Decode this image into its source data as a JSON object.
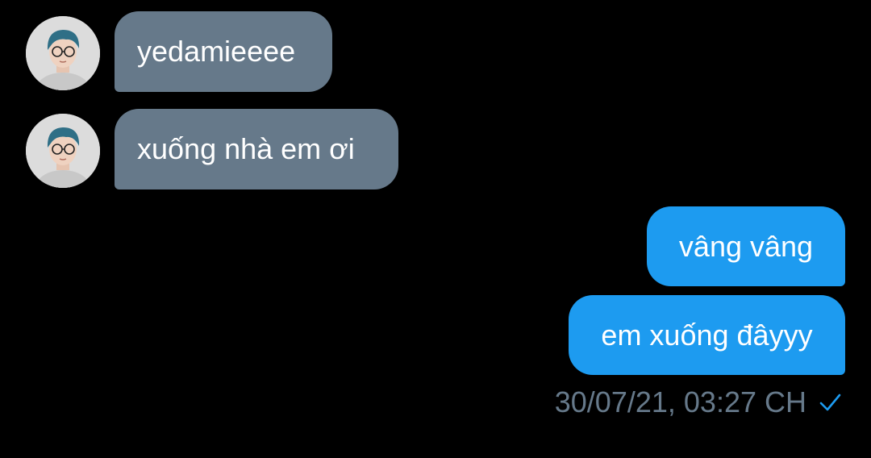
{
  "conversation": {
    "messages": [
      {
        "direction": "incoming",
        "text": "yedamieeee"
      },
      {
        "direction": "incoming",
        "text": "xuống nhà em ơi"
      },
      {
        "direction": "outgoing",
        "text": "vâng vâng"
      },
      {
        "direction": "outgoing",
        "text": "em xuống đâyyy"
      }
    ],
    "timestamp": "30/07/21, 03:27 CH"
  },
  "icons": {
    "sent_status": "check-icon",
    "avatar": "avatar-photo"
  },
  "colors": {
    "background": "#000000",
    "incoming_bubble": "#66798a",
    "outgoing_bubble": "#1d9bf0",
    "timestamp_text": "#66798a",
    "message_text": "#ffffff"
  }
}
